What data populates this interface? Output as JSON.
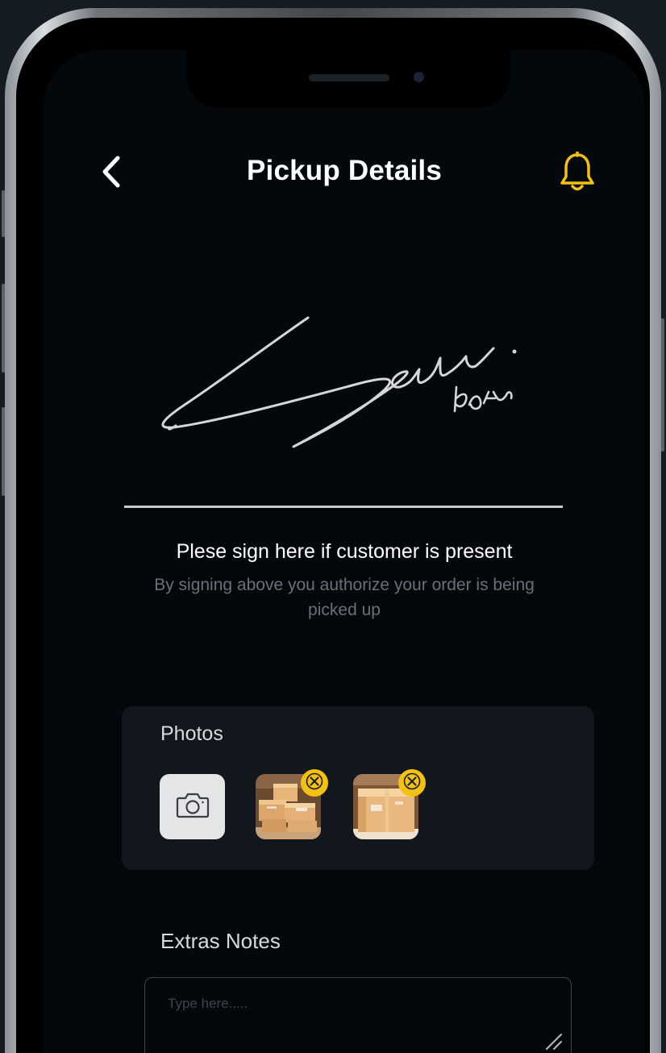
{
  "header": {
    "title": "Pickup Details",
    "back_icon": "chevron-left-icon",
    "bell_icon": "bell-icon"
  },
  "signature": {
    "title": "Plese sign here if customer is present",
    "subtitle": "By signing above you authorize your order is being picked up"
  },
  "photos": {
    "label": "Photos",
    "camera_icon": "camera-icon",
    "items": [
      {
        "thumbnail": "boxes-stack-photo",
        "remove_icon": "close-icon"
      },
      {
        "thumbnail": "single-box-photo",
        "remove_icon": "close-icon"
      }
    ]
  },
  "notes": {
    "label": "Extras Notes",
    "placeholder": "Type here.....",
    "value": ""
  },
  "colors": {
    "accent": "#f3c111",
    "background": "#03080d",
    "card": "#11171d",
    "muted_text": "#6b7076"
  }
}
